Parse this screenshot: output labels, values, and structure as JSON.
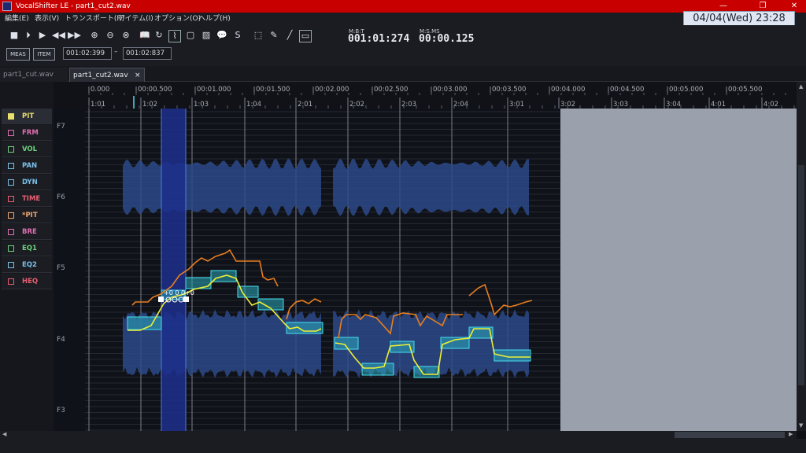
{
  "window": {
    "title": "VocalShifter LE - part1_cut2.wav",
    "minimize_glyph": "—",
    "restore_glyph": "❐",
    "close_glyph": "✕",
    "clock": "04/04(Wed) 23:28"
  },
  "menu": [
    "編集(E)",
    "表示(V)",
    "トランスポート(R)",
    "アイテム(I)",
    "オプション(O)",
    "ヘルプ(H)"
  ],
  "toolbar": {
    "icons": [
      "stop-icon",
      "play-from-start-icon",
      "play-icon",
      "rewind-icon",
      "fast-forward-icon",
      "zoom-in-icon",
      "zoom-out-icon",
      "zoom-fit-icon",
      "loop-icon",
      "repeat-icon",
      "pitch-draw-icon",
      "box-select-icon",
      "image-icon",
      "comment-icon",
      "snap-s-icon",
      "marquee-icon",
      "pencil-icon",
      "line-icon",
      "rect-icon"
    ],
    "glyphs": [
      "■",
      "⏵",
      "▶",
      "◀◀",
      "▶▶",
      "⊕",
      "⊖",
      "⊗",
      "📖",
      "↻",
      "⌇",
      "▢",
      "▨",
      "💬",
      "S",
      "⬚",
      "✎",
      "╱",
      "▭"
    ],
    "selected": [
      "pitch-draw-icon",
      "rect-icon"
    ],
    "meas_label": "MEAS",
    "item_label": "ITEM",
    "range_start": "001:02:399",
    "range_sep": "–",
    "range_end": "001:02:837",
    "mbt_label": "M:B:T",
    "mbt_value": "001:01:274",
    "msms_label": "M:S.MS",
    "msms_value": "00:00.125"
  },
  "tabs": [
    {
      "label": "part1_cut.wav",
      "active": false
    },
    {
      "label": "part1_cut2.wav",
      "active": true,
      "close": "×"
    }
  ],
  "sidebar": [
    {
      "label": "PIT",
      "color": "#e8e06a",
      "active": true,
      "checked": true
    },
    {
      "label": "FRM",
      "color": "#e06fb0"
    },
    {
      "label": "VOL",
      "color": "#6ed47a"
    },
    {
      "label": "PAN",
      "color": "#7ac0e8"
    },
    {
      "label": "DYN",
      "color": "#7ac0e8"
    },
    {
      "label": "TIME",
      "color": "#e85f72"
    },
    {
      "label": "*PIT",
      "color": "#f0a870"
    },
    {
      "label": "BRE",
      "color": "#e06fb0"
    },
    {
      "label": "EQ1",
      "color": "#6ed47a"
    },
    {
      "label": "EQ2",
      "color": "#7ac0e8"
    },
    {
      "label": "HEQ",
      "color": "#e85f72"
    }
  ],
  "ruler": {
    "time_labels": [
      "0.000",
      "00:00.500",
      "00:01.000",
      "00:01.500",
      "00:02.000",
      "00:02.500",
      "00:03.000",
      "00:03.500",
      "00:04.000",
      "00:04.500",
      "00:05.000",
      "00:05.500"
    ],
    "measure_labels": [
      "1:01",
      "1:02",
      "1:03",
      "1:04",
      "2:01",
      "2:02",
      "2:03",
      "2:04",
      "3:01",
      "3:02",
      "3:03",
      "3:04",
      "4:01",
      "4:02"
    ]
  },
  "pitch_labels": [
    "F7",
    "F6",
    "F5",
    "F4",
    "F3"
  ],
  "note_edit_label": "+0 0 0+0"
}
